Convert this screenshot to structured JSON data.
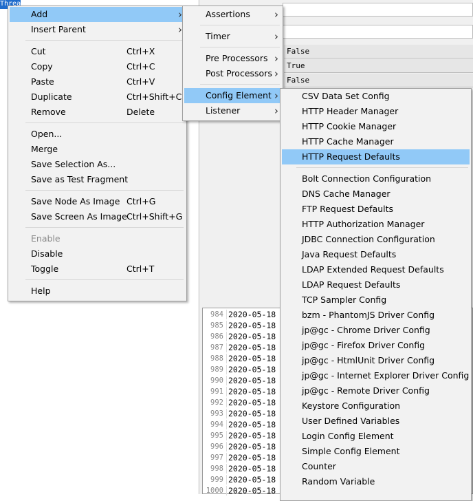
{
  "tree": {
    "selected_node": "Thread"
  },
  "right_panel": {
    "values": [
      "False",
      "True",
      "False"
    ],
    "log_rows": [
      {
        "n": "984",
        "d": "2020-05-18"
      },
      {
        "n": "985",
        "d": "2020-05-18"
      },
      {
        "n": "986",
        "d": "2020-05-18"
      },
      {
        "n": "987",
        "d": "2020-05-18"
      },
      {
        "n": "988",
        "d": "2020-05-18"
      },
      {
        "n": "989",
        "d": "2020-05-18"
      },
      {
        "n": "990",
        "d": "2020-05-18"
      },
      {
        "n": "991",
        "d": "2020-05-18"
      },
      {
        "n": "992",
        "d": "2020-05-18"
      },
      {
        "n": "993",
        "d": "2020-05-18"
      },
      {
        "n": "994",
        "d": "2020-05-18"
      },
      {
        "n": "995",
        "d": "2020-05-18"
      },
      {
        "n": "996",
        "d": "2020-05-18"
      },
      {
        "n": "997",
        "d": "2020-05-18"
      },
      {
        "n": "998",
        "d": "2020-05-18"
      },
      {
        "n": "999",
        "d": "2020-05-18"
      },
      {
        "n": "1000",
        "d": "2020-05-18"
      }
    ]
  },
  "context_menu": [
    {
      "label": "Add",
      "sub": true,
      "hl": true
    },
    {
      "label": "Insert Parent",
      "sub": true
    },
    {
      "sep": true
    },
    {
      "label": "Cut",
      "shortcut": "Ctrl+X"
    },
    {
      "label": "Copy",
      "shortcut": "Ctrl+C"
    },
    {
      "label": "Paste",
      "shortcut": "Ctrl+V"
    },
    {
      "label": "Duplicate",
      "shortcut": "Ctrl+Shift+C"
    },
    {
      "label": "Remove",
      "shortcut": "Delete"
    },
    {
      "sep": true
    },
    {
      "label": "Open..."
    },
    {
      "label": "Merge"
    },
    {
      "label": "Save Selection As..."
    },
    {
      "label": "Save as Test Fragment"
    },
    {
      "sep": true
    },
    {
      "label": "Save Node As Image",
      "shortcut": "Ctrl+G"
    },
    {
      "label": "Save Screen As Image",
      "shortcut": "Ctrl+Shift+G"
    },
    {
      "sep": true
    },
    {
      "label": "Enable",
      "disabled": true
    },
    {
      "label": "Disable"
    },
    {
      "label": "Toggle",
      "shortcut": "Ctrl+T"
    },
    {
      "sep": true
    },
    {
      "label": "Help"
    }
  ],
  "add_menu": [
    {
      "label": "Assertions",
      "sub": true
    },
    {
      "sep": true,
      "gap": 10
    },
    {
      "label": "Timer",
      "sub": true
    },
    {
      "sep": true
    },
    {
      "label": "Pre Processors",
      "sub": true
    },
    {
      "label": "Post Processors",
      "sub": true
    },
    {
      "sep": true
    },
    {
      "label": "Config Element",
      "sub": true,
      "hl": true
    },
    {
      "label": "Listener",
      "sub": true
    }
  ],
  "config_menu": [
    {
      "label": "CSV Data Set Config"
    },
    {
      "label": "HTTP Header Manager"
    },
    {
      "label": "HTTP Cookie Manager"
    },
    {
      "label": "HTTP Cache Manager"
    },
    {
      "label": "HTTP Request Defaults",
      "hl": true
    },
    {
      "sep": true
    },
    {
      "label": "Bolt Connection Configuration"
    },
    {
      "label": "DNS Cache Manager"
    },
    {
      "label": "FTP Request Defaults"
    },
    {
      "label": "HTTP Authorization Manager"
    },
    {
      "label": "JDBC Connection Configuration"
    },
    {
      "label": "Java Request Defaults"
    },
    {
      "label": "LDAP Extended Request Defaults"
    },
    {
      "label": "LDAP Request Defaults"
    },
    {
      "label": "TCP Sampler Config"
    },
    {
      "label": "bzm - PhantomJS Driver Config"
    },
    {
      "label": "jp@gc - Chrome Driver Config"
    },
    {
      "label": "jp@gc - Firefox Driver Config"
    },
    {
      "label": "jp@gc - HtmlUnit Driver Config"
    },
    {
      "label": "jp@gc - Internet Explorer Driver Config"
    },
    {
      "label": "jp@gc - Remote Driver Config"
    },
    {
      "label": "Keystore Configuration"
    },
    {
      "label": "User Defined Variables"
    },
    {
      "label": "Login Config Element"
    },
    {
      "label": "Simple Config Element"
    },
    {
      "label": "Counter"
    },
    {
      "label": "Random Variable"
    }
  ],
  "colors": {
    "highlight": "#91c9f7",
    "menu_bg": "#f2f2f2"
  }
}
